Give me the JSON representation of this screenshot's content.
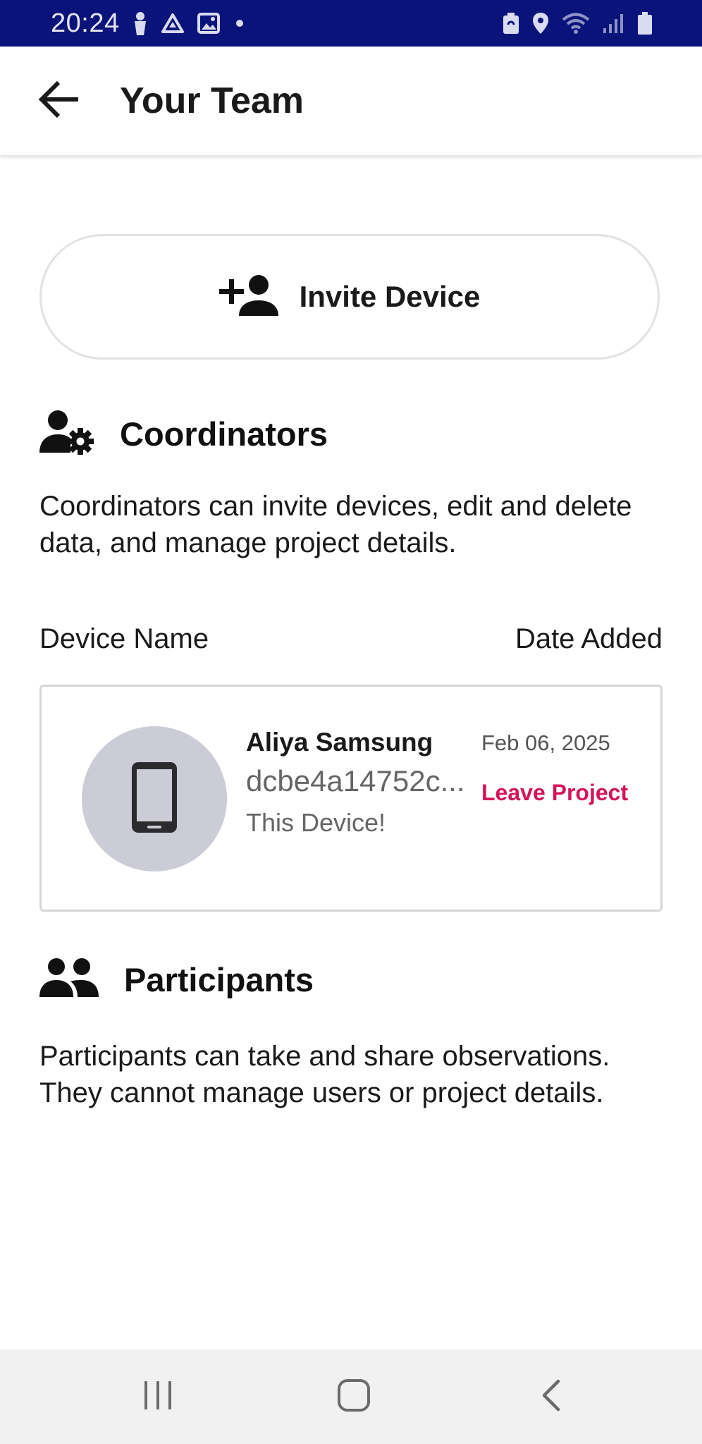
{
  "status_bar": {
    "time": "20:24",
    "background": "#0a137a",
    "left_icons": [
      "person-pin-icon",
      "drive-icon",
      "image-icon",
      "dot-icon"
    ],
    "right_icons": [
      "battery-saver-icon",
      "location-icon",
      "wifi-icon",
      "signal-icon",
      "battery-icon"
    ]
  },
  "app_bar": {
    "title": "Your Team",
    "back_icon": "arrow-left-icon"
  },
  "invite": {
    "label": "Invite Device",
    "icon": "person-add-icon"
  },
  "coordinators": {
    "title": "Coordinators",
    "icon": "user-gear-icon",
    "description": "Coordinators can invite devices, edit and delete data, and manage project details."
  },
  "table": {
    "col_name": "Device Name",
    "col_date": "Date Added"
  },
  "device": {
    "name": "Aliya Samsung",
    "id": "dcbe4a14752c...",
    "note": "This Device!",
    "date": "Feb 06, 2025",
    "action": "Leave Project",
    "icon": "smartphone-icon",
    "accent": "#d3145a"
  },
  "participants": {
    "title": "Participants",
    "icon": "group-icon",
    "description": "Participants can take and share observations. They cannot manage users or project details."
  },
  "nav_bar": {
    "icons": [
      "recent-apps-icon",
      "home-icon",
      "back-chevron-icon"
    ]
  }
}
